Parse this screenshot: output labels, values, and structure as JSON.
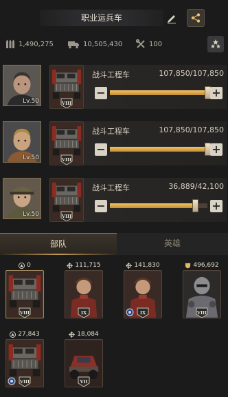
{
  "header": {
    "title": "职业运兵车"
  },
  "stats": {
    "ammo": "1,490,275",
    "transport": "10,505,430",
    "tools": "100"
  },
  "assignments": [
    {
      "hero_level": "Lv.50",
      "unit_name": "战斗工程车",
      "rank": "VIII",
      "count_text": "107,850/107,850",
      "fill_fraction": 1.0
    },
    {
      "hero_level": "Lv.50",
      "unit_name": "战斗工程车",
      "rank": "VIII",
      "count_text": "107,850/107,850",
      "fill_fraction": 1.0
    },
    {
      "hero_level": "Lv.50",
      "unit_name": "战斗工程车",
      "rank": "VIII",
      "count_text": "36,889/42,100",
      "fill_fraction": 0.876
    }
  ],
  "tabs": {
    "troops": "部队",
    "heroes": "英雄"
  },
  "troop_slots": [
    {
      "value": "0",
      "icon": "triangle-icon",
      "rank": "VIII",
      "kind": "vehicle"
    },
    {
      "value": "111,715",
      "icon": "crosshair-icon",
      "rank": "IX",
      "kind": "soldier"
    },
    {
      "value": "141,830",
      "icon": "crosshair-icon",
      "rank": "IX",
      "kind": "soldier"
    },
    {
      "value": "496,692",
      "icon": "shield-icon",
      "rank": "VIII",
      "kind": "armored"
    },
    {
      "value": "27,843",
      "icon": "triangle-icon",
      "rank": "VIII",
      "kind": "vehicle"
    },
    {
      "value": "18,084",
      "icon": "crosshair-icon",
      "rank": "VII",
      "kind": "buggy"
    }
  ],
  "colors": {
    "accent_gold": "#c58c30",
    "panel": "#242322",
    "background": "#1b1b1c"
  }
}
